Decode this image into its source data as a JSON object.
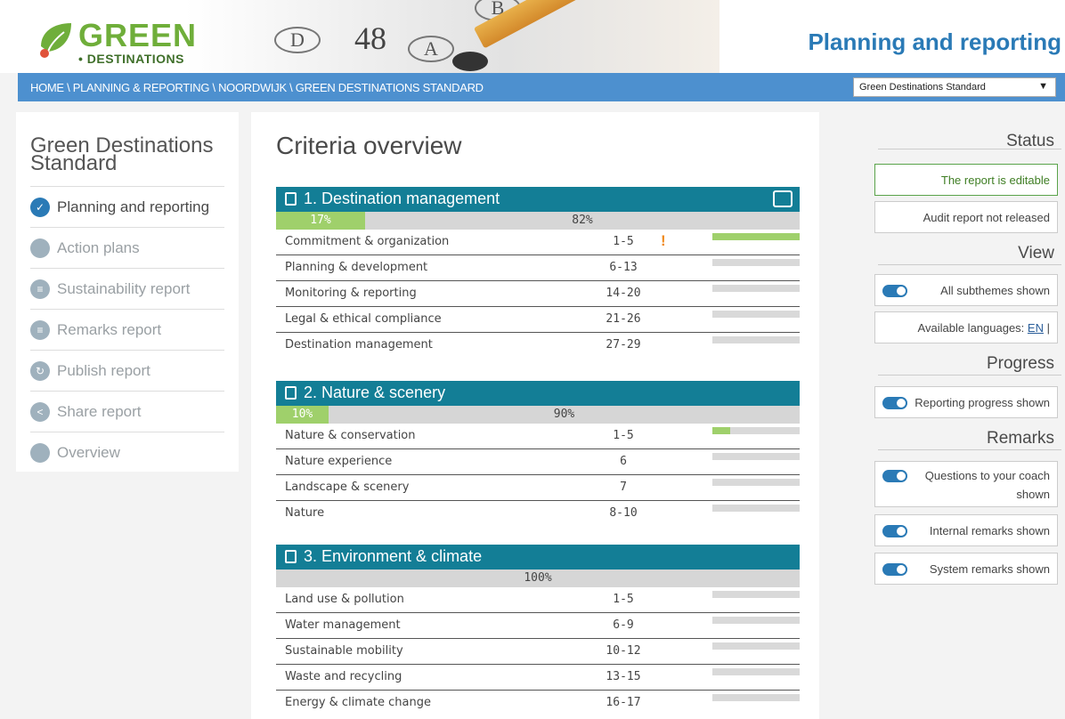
{
  "header": {
    "logo_word": "GREEN",
    "logo_sub": "DESTINATIONS",
    "title": "Planning and reporting",
    "hero": {
      "bubble_d": "D",
      "bubble_a": "A",
      "bubble_b": "B",
      "number": "48"
    },
    "breadcrumb": "HOME \\  PLANNING & REPORTING \\ NOORDWIJK \\ GREEN DESTINATIONS STANDARD",
    "standard_select": {
      "value": "Green Destinations Standard",
      "arrow": "▼"
    }
  },
  "sidebar": {
    "title": "Green Destinations Standard",
    "items": [
      {
        "label": "Planning and reporting",
        "icon": "check-icon",
        "glyph": "✓"
      },
      {
        "label": "Action plans",
        "icon": "action-plans-icon",
        "glyph": ""
      },
      {
        "label": "Sustainability report",
        "icon": "sustainability-report-icon",
        "glyph": "≡"
      },
      {
        "label": "Remarks report",
        "icon": "remarks-report-icon",
        "glyph": "≡"
      },
      {
        "label": "Publish report",
        "icon": "publish-icon",
        "glyph": "↻"
      },
      {
        "label": "Share report",
        "icon": "share-icon",
        "glyph": "<"
      },
      {
        "label": "Overview",
        "icon": "overview-icon",
        "glyph": ""
      }
    ]
  },
  "main": {
    "title": "Criteria overview",
    "sections": [
      {
        "title": "1. Destination management",
        "progress_done": 0.17,
        "done_label": "17%",
        "rest_label": "82%",
        "has_comment": true,
        "rows": [
          {
            "name": "Commitment & organization",
            "range": "1-5",
            "warn": "!",
            "fill": 1.0
          },
          {
            "name": "Planning & development",
            "range": "6-13",
            "warn": "",
            "fill": 0
          },
          {
            "name": "Monitoring & reporting",
            "range": "14-20",
            "warn": "",
            "fill": 0
          },
          {
            "name": "Legal & ethical compliance",
            "range": "21-26",
            "warn": "",
            "fill": 0
          },
          {
            "name": "Destination management",
            "range": "27-29",
            "warn": "",
            "fill": 0
          }
        ]
      },
      {
        "title": "2. Nature & scenery",
        "progress_done": 0.1,
        "done_label": "10%",
        "rest_label": "90%",
        "has_comment": false,
        "rows": [
          {
            "name": "Nature & conservation",
            "range": "1-5",
            "warn": "",
            "fill": 0.2
          },
          {
            "name": "Nature experience",
            "range": "6",
            "warn": "",
            "fill": 0
          },
          {
            "name": "Landscape & scenery",
            "range": "7",
            "warn": "",
            "fill": 0
          },
          {
            "name": "Nature",
            "range": "8-10",
            "warn": "",
            "fill": 0
          }
        ]
      },
      {
        "title": "3. Environment & climate",
        "progress_done": 0,
        "done_label": "",
        "rest_label": "100%",
        "has_comment": false,
        "rows": [
          {
            "name": "Land use & pollution",
            "range": "1-5",
            "warn": "",
            "fill": 0
          },
          {
            "name": "Water management",
            "range": "6-9",
            "warn": "",
            "fill": 0
          },
          {
            "name": "Sustainable mobility",
            "range": "10-12",
            "warn": "",
            "fill": 0
          },
          {
            "name": "Waste and recycling",
            "range": "13-15",
            "warn": "",
            "fill": 0
          },
          {
            "name": "Energy & climate change",
            "range": "16-17",
            "warn": "",
            "fill": 0
          }
        ]
      }
    ]
  },
  "right": {
    "status_heading": "Status",
    "editable": "The report is editable",
    "audit": "Audit report not released",
    "view_heading": "View",
    "subthemes": "All subthemes shown",
    "languages_label": "Available languages:",
    "languages_link": "EN",
    "languages_sep": "|",
    "progress_heading": "Progress",
    "reporting_progress": "Reporting progress shown",
    "remarks_heading": "Remarks",
    "coach": "Questions to your coach shown",
    "internal": "Internal remarks shown",
    "system": "System remarks shown"
  },
  "colors": {
    "brand_blue": "#2a7ab6",
    "section_teal": "#137e96",
    "progress_green": "#9fd06b",
    "warn_orange": "#f08a1c"
  }
}
